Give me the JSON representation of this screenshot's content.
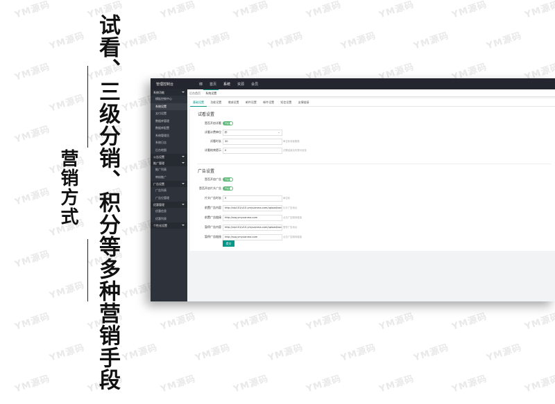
{
  "watermark": {
    "text": "YM源码"
  },
  "promo": {
    "headline": "试看、三级分销、积分等多种营销手段",
    "side_label": "营销方式"
  },
  "admin": {
    "brand": "管理控制台",
    "top_nav": [
      "绑",
      "首页",
      "系统",
      "资源",
      "会员"
    ],
    "sidebar": {
      "groups": [
        {
          "label": "系统功能",
          "items": [
            "模板控制中心",
            "系统设置",
            "支付设置",
            "数据库管理",
            "数据库配置",
            "系统管理员",
            "系统日志",
            "后台地图"
          ]
        },
        {
          "label": "公告设置",
          "items": []
        },
        {
          "label": "推广管理",
          "items": [
            "推广列表",
            "审核推广"
          ]
        },
        {
          "label": "广告设置",
          "items": [
            "广告列表",
            "广告位管理"
          ]
        },
        {
          "label": "优惠管理",
          "items": [
            "优惠信息",
            "优惠列表"
          ]
        },
        {
          "label": "个性化设置",
          "items": []
        }
      ]
    },
    "page_tabs": [
      "后台首页",
      "系统设置"
    ],
    "sub_tabs": [
      "基础设置",
      "功能设置",
      "增减设置",
      "邮件设置",
      "邮件设置",
      "短信设置",
      "友情链接"
    ],
    "trial_section": {
      "title": "试看设置",
      "rows": [
        {
          "label": "是否开启试看",
          "type": "toggle",
          "value": "开启"
        },
        {
          "label": "试看计费单位",
          "type": "select",
          "value": "秒",
          "hint": ""
        },
        {
          "label": "试看时长",
          "type": "input",
          "value": "30",
          "hint": "单位秒或者集数"
        },
        {
          "label": "试看结束提示",
          "type": "input",
          "value": "0",
          "hint": "试看结束后的提示信息"
        }
      ]
    },
    "ad_section": {
      "title": "广告设置",
      "rows": [
        {
          "label": "是否开启广告",
          "type": "toggle",
          "value": "开启"
        },
        {
          "label": "是否开启片头广告",
          "type": "toggle",
          "value": "开启"
        },
        {
          "label": "片头广告时长",
          "type": "input",
          "value": "5",
          "hint": "单位秒"
        },
        {
          "label": "前置广告内容",
          "type": "input",
          "value": "http://vip101/v10.ymyuanma.com/upload/vod/201",
          "hint": "片头广告地址"
        },
        {
          "label": "前置广告链接",
          "type": "input",
          "value": "http://ssq.ymyuanma.com",
          "hint": "点击广告跳转链接"
        },
        {
          "label": "暂停广告内容",
          "type": "input",
          "value": "http://vip101/v10.ymyuanma.com/upload/vod/201",
          "hint": "暂停广告地址"
        },
        {
          "label": "暂停广告链接",
          "type": "input",
          "value": "http://ssq.ymyuanma.com",
          "hint": "点击广告跳转链接"
        }
      ]
    },
    "submit_label": "提交"
  }
}
